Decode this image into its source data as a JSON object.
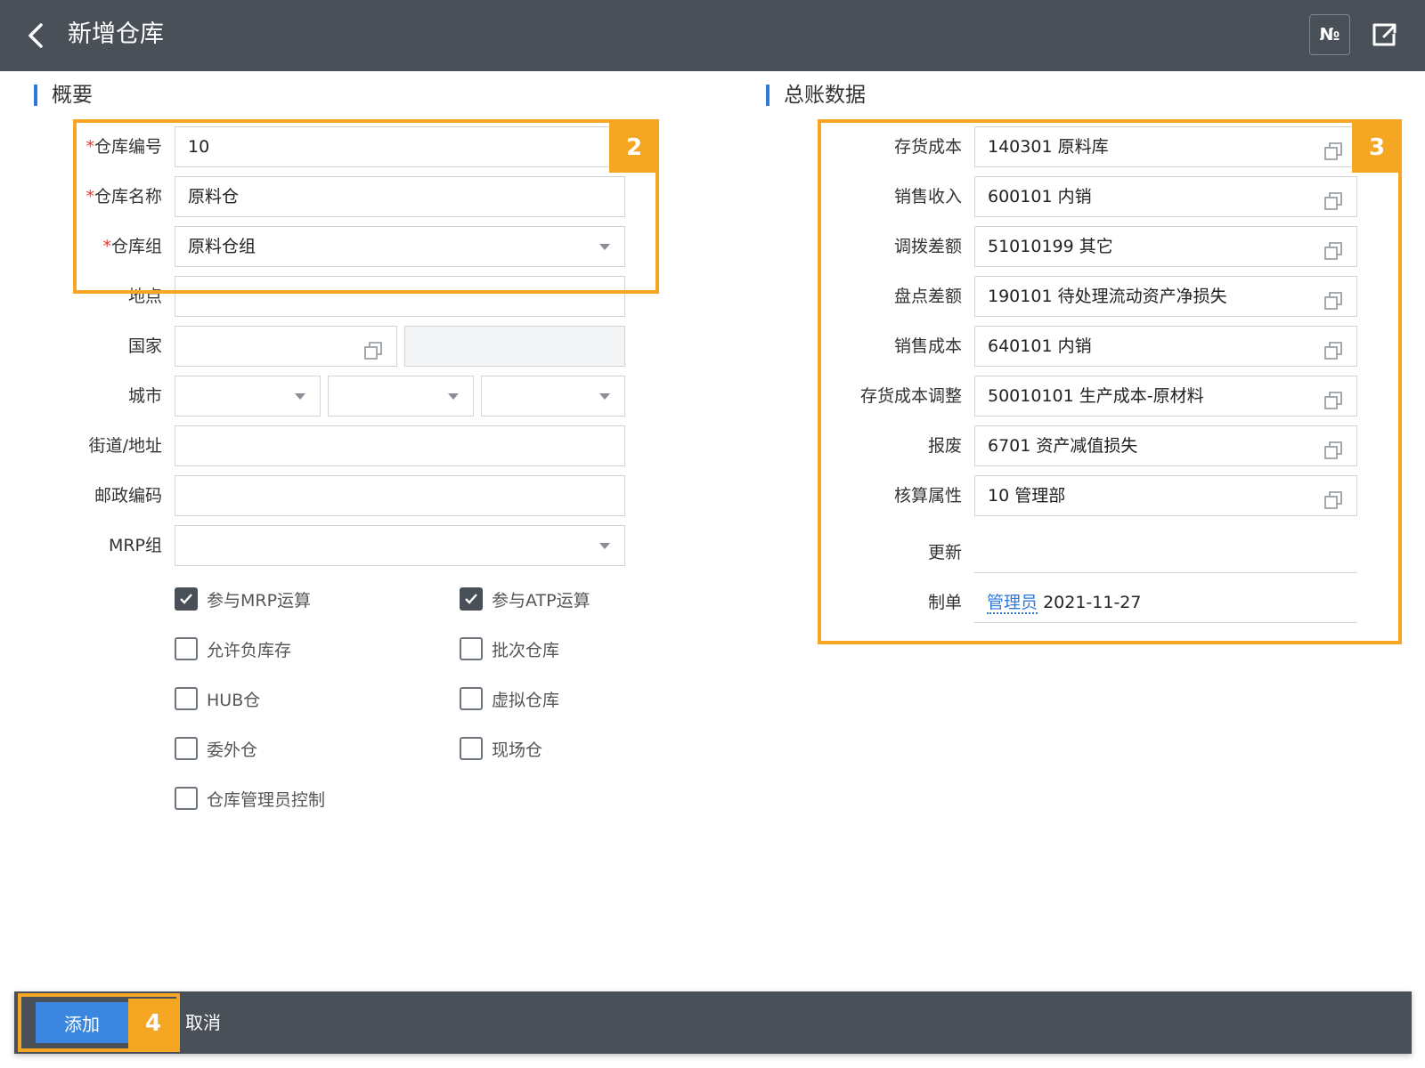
{
  "header": {
    "title": "新增仓库",
    "number_button": "№"
  },
  "overview": {
    "section_title": "概要",
    "required_mark": "*",
    "warehouse_code": {
      "label": "仓库编号",
      "value": "10"
    },
    "warehouse_name": {
      "label": "仓库名称",
      "value": "原料仓"
    },
    "warehouse_group": {
      "label": "仓库组",
      "value": "原料仓组"
    },
    "location": {
      "label": "地点",
      "value": ""
    },
    "country": {
      "label": "国家",
      "value": ""
    },
    "city": {
      "label": "城市"
    },
    "street": {
      "label": "街道/地址",
      "value": ""
    },
    "postal": {
      "label": "邮政编码",
      "value": ""
    },
    "mrp_group": {
      "label": "MRP组",
      "value": ""
    },
    "checkboxes": [
      {
        "label": "参与MRP运算",
        "checked": true
      },
      {
        "label": "参与ATP运算",
        "checked": true
      },
      {
        "label": "允许负库存",
        "checked": false
      },
      {
        "label": "批次仓库",
        "checked": false
      },
      {
        "label": "HUB仓",
        "checked": false
      },
      {
        "label": "虚拟仓库",
        "checked": false
      },
      {
        "label": "委外仓",
        "checked": false
      },
      {
        "label": "现场仓",
        "checked": false
      },
      {
        "label": "仓库管理员控制",
        "checked": false
      }
    ]
  },
  "ledger": {
    "section_title": "总账数据",
    "fields": [
      {
        "label": "存货成本",
        "value": "140301 原料库"
      },
      {
        "label": "销售收入",
        "value": "600101 内销"
      },
      {
        "label": "调拨差额",
        "value": "51010199 其它"
      },
      {
        "label": "盘点差额",
        "value": "190101 待处理流动资产净损失"
      },
      {
        "label": "销售成本",
        "value": "640101 内销"
      },
      {
        "label": "存货成本调整",
        "value": "50010101 生产成本-原材料"
      },
      {
        "label": "报废",
        "value": "6701 资产减值损失"
      },
      {
        "label": "核算属性",
        "value": "10 管理部"
      }
    ],
    "updated": {
      "label": "更新",
      "value": ""
    },
    "created": {
      "label": "制单",
      "user": "管理员",
      "date": "2021-11-27"
    }
  },
  "annotations": {
    "badge_2": "2",
    "badge_3": "3",
    "badge_4": "4"
  },
  "footer": {
    "add_label": "添加",
    "cancel_label": "取消"
  },
  "colors": {
    "header_bg": "#4a5058",
    "accent": "#2f7ad8",
    "highlight": "#f5a623",
    "primary_button": "#3a86e0"
  }
}
